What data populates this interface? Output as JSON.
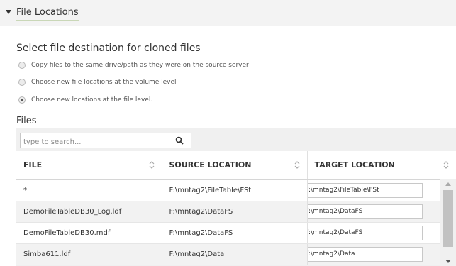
{
  "section": {
    "title": "File Locations"
  },
  "prompt": "Select file destination for cloned files",
  "options": [
    {
      "label": "Copy files to the same drive/path as they were on the source server",
      "checked": false
    },
    {
      "label": "Choose new file locations at the volume level",
      "checked": false
    },
    {
      "label": "Choose new locations at the file level.",
      "checked": true
    }
  ],
  "files": {
    "label": "Files",
    "search_placeholder": "type to search...",
    "columns": [
      "FILE",
      "SOURCE LOCATION",
      "TARGET LOCATION"
    ],
    "rows": [
      {
        "file": "*",
        "source": "F:\\mntag2\\FileTable\\FSt",
        "target": "F:\\mntag2\\FileTable\\FSt"
      },
      {
        "file": "DemoFileTableDB30_Log.ldf",
        "source": "F:\\mntag2\\DataFS",
        "target": "F:\\mntag2\\DataFS"
      },
      {
        "file": "DemoFileTableDB30.mdf",
        "source": "F:\\mntag2\\DataFS",
        "target": "F:\\mntag2\\DataFS"
      },
      {
        "file": "Simba611.ldf",
        "source": "F:\\mntag2\\Data",
        "target": "F:\\mntag2\\Data"
      }
    ]
  },
  "icons": {
    "caret": "caret-down-icon",
    "search": "search-icon",
    "sort": "sort-icon"
  }
}
